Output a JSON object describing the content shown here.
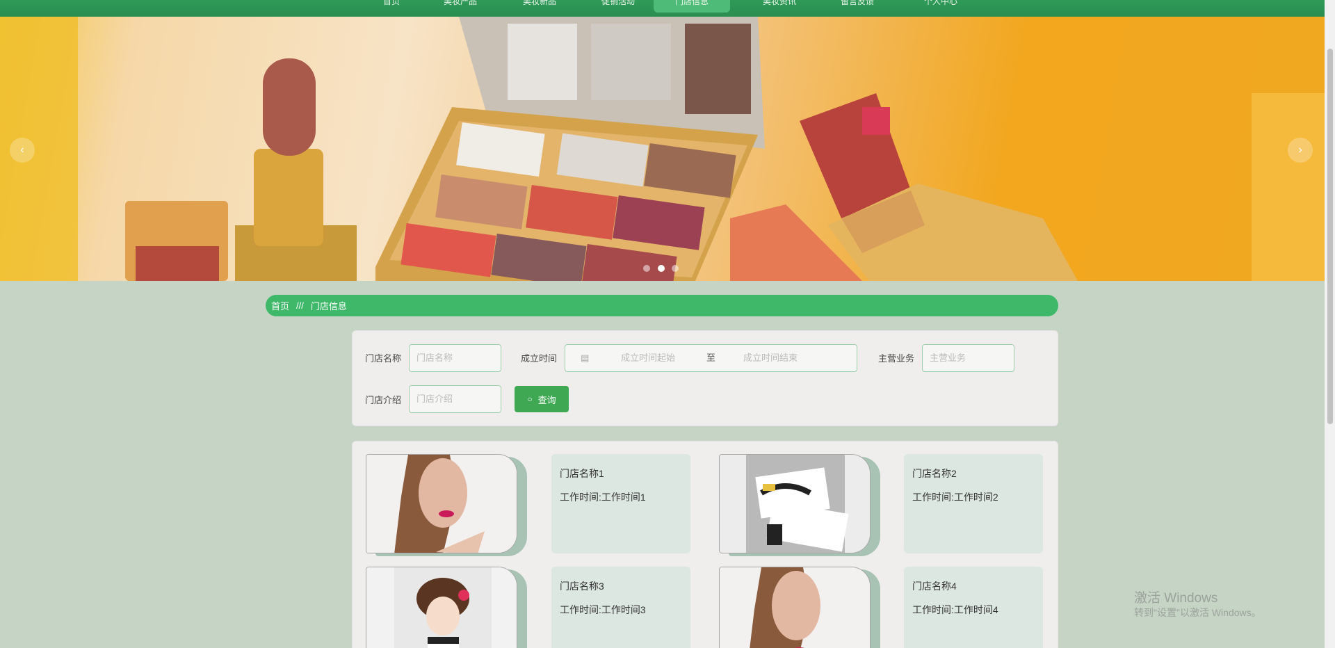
{
  "nav": {
    "items": [
      "首页",
      "美妆产品",
      "美妆新品",
      "促销活动",
      "门店信息",
      "美妆资讯",
      "留言反馈",
      "个人中心"
    ]
  },
  "banner": {
    "prev_label": "‹",
    "next_label": "›",
    "active_dot": 1
  },
  "breadcrumb": {
    "home": "首页",
    "separator": "///",
    "current": "门店信息"
  },
  "search": {
    "store_name_label": "门店名称",
    "store_name_placeholder": "门店名称",
    "founded_label": "成立时间",
    "founded_start_placeholder": "成立时间起始",
    "founded_to": "至",
    "founded_end_placeholder": "成立时间结束",
    "business_label": "主营业务",
    "business_placeholder": "主营业务",
    "intro_label": "门店介绍",
    "intro_placeholder": "门店介绍",
    "button_label": "查询"
  },
  "stores": [
    {
      "name": "门店名称1",
      "hours": "工作时间:工作时间1"
    },
    {
      "name": "门店名称2",
      "hours": "工作时间:工作时间2"
    },
    {
      "name": "门店名称3",
      "hours": "工作时间:工作时间3"
    },
    {
      "name": "门店名称4",
      "hours": "工作时间:工作时间4"
    }
  ],
  "watermark": {
    "line1": "激活 Windows",
    "line2": "转到\"设置\"以激活 Windows。"
  },
  "colors": {
    "nav_green": "#2f9a58",
    "breadcrumb_green": "#3fb86a",
    "button_green": "#3fa853",
    "page_bg": "#c6d4c6"
  }
}
